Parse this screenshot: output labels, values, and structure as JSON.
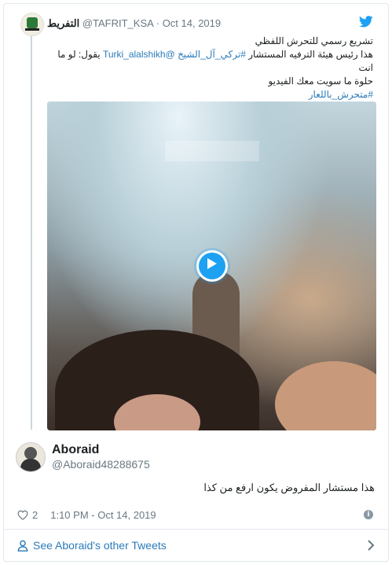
{
  "quoted_tweet": {
    "name": "التفريط",
    "handle": "@TAFRIT_KSA",
    "separator": "·",
    "date": "Oct 14, 2019",
    "line1": "تشريع رسمي للتحرش اللفظي",
    "line2_prefix": "هذا رئيس هيئة الترفيه المستشار ",
    "line2_hashtag": "#تركي_آل_الشيخ",
    "line2_mention": "@Turki_alalshikh",
    "line2_suffix": " يقول: لو ما انت",
    "line3": "حلوة ما سويت معك الفيديو",
    "line4_hashtag": "#متحرش_باللعار"
  },
  "author": {
    "name": "Aboraid",
    "handle": "@Aboraid48288675"
  },
  "tweet": {
    "text": "هذا مستشار المفروض يكون ارفع من كذا"
  },
  "meta": {
    "likes": "2",
    "timestamp": "1:10 PM - Oct 14, 2019"
  },
  "footer": {
    "link": "See Aboraid's other Tweets"
  },
  "icons": {
    "brand": "twitter-bird-icon",
    "like": "heart-icon",
    "info": "info-icon",
    "profile": "person-icon",
    "chevron": "chevron-right-icon",
    "play": "play-icon"
  },
  "colors": {
    "accent": "#1da1f2",
    "link": "#2b7bb9",
    "secondary_text": "#697882",
    "border": "#e1e8ed"
  }
}
